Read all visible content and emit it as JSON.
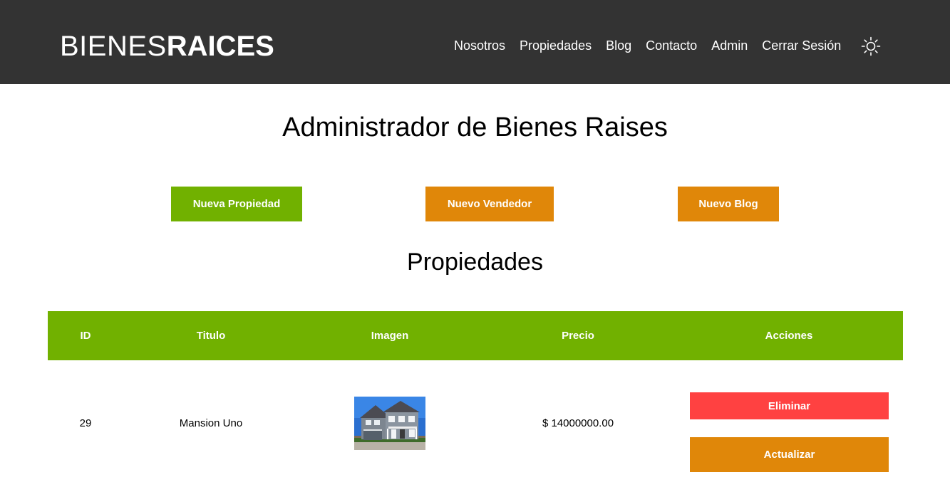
{
  "header": {
    "logo_light": "BIENES",
    "logo_bold": "RAICES",
    "nav": [
      "Nosotros",
      "Propiedades",
      "Blog",
      "Contacto",
      "Admin",
      "Cerrar Sesión"
    ],
    "theme_icon": "sun-icon",
    "background": "#333333"
  },
  "main": {
    "title": "Administrador de Bienes Raises",
    "actions": {
      "new_property": "Nueva Propiedad",
      "new_seller": "Nuevo Vendedor",
      "new_blog": "Nuevo Blog"
    },
    "section_title": "Propiedades"
  },
  "table": {
    "columns": [
      "ID",
      "Titulo",
      "Imagen",
      "Precio",
      "Acciones"
    ],
    "rows": [
      {
        "id": "29",
        "titulo": "Mansion Uno",
        "precio": "$ 14000000.00",
        "delete_label": "Eliminar",
        "update_label": "Actualizar"
      }
    ]
  },
  "colors": {
    "green": "#71b100",
    "orange": "#e08709",
    "red": "#ff4141"
  }
}
